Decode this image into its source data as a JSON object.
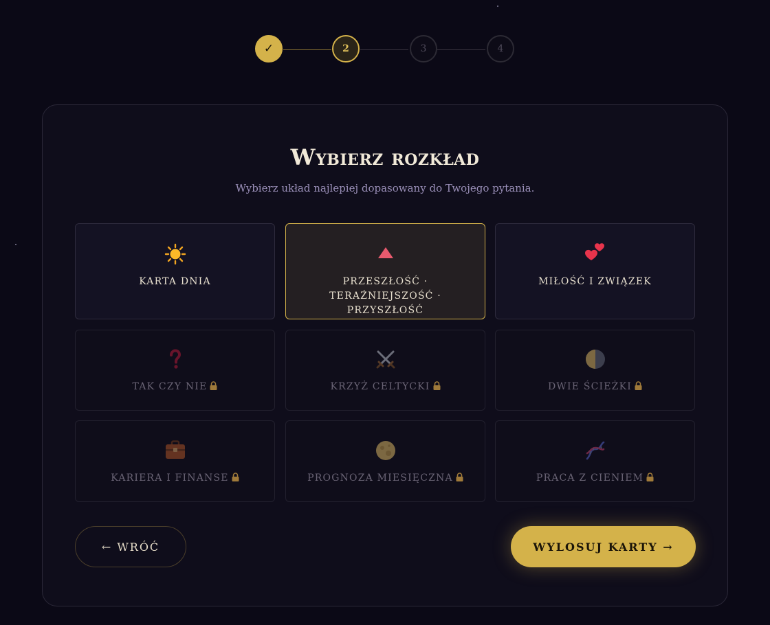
{
  "stepper": {
    "steps": [
      {
        "label": "✓",
        "state": "complete"
      },
      {
        "label": "2",
        "state": "active"
      },
      {
        "label": "3",
        "state": "pending"
      },
      {
        "label": "4",
        "state": "pending"
      }
    ]
  },
  "panel": {
    "title": "Wybierz rozkład",
    "subtitle": "Wybierz układ najlepiej dopasowany do Twojego pytania."
  },
  "spreads": [
    {
      "label": "KARTA DNIA",
      "icon": "sun-icon",
      "locked": false,
      "selected": false
    },
    {
      "label": "PRZESZŁOŚĆ · TERAŹNIEJSZOŚĆ · PRZYSZŁOŚĆ",
      "icon": "triangle-icon",
      "locked": false,
      "selected": true
    },
    {
      "label": "MIŁOŚĆ I ZWIĄZEK",
      "icon": "two-hearts-icon",
      "locked": false,
      "selected": false
    },
    {
      "label": "TAK CZY NIE",
      "icon": "question-mark-icon",
      "locked": true,
      "selected": false
    },
    {
      "label": "KRZYŻ CELTYCKI",
      "icon": "crossed-swords-icon",
      "locked": true,
      "selected": false
    },
    {
      "label": "DWIE ŚCIEŻKI",
      "icon": "half-moon-icon",
      "locked": true,
      "selected": false
    },
    {
      "label": "KARIERA I FINANSE",
      "icon": "briefcase-icon",
      "locked": true,
      "selected": false
    },
    {
      "label": "PROGNOZA MIESIĘCZNA",
      "icon": "full-moon-icon",
      "locked": true,
      "selected": false
    },
    {
      "label": "PRACA Z CIENIEM",
      "icon": "dna-icon",
      "locked": true,
      "selected": false
    }
  ],
  "buttons": {
    "back": "← WRÓĆ",
    "draw": "WYLOSUJ KARTY →"
  },
  "colors": {
    "accent": "#d4b24a",
    "background": "#0b0916",
    "panel": "#0f0d1b"
  }
}
